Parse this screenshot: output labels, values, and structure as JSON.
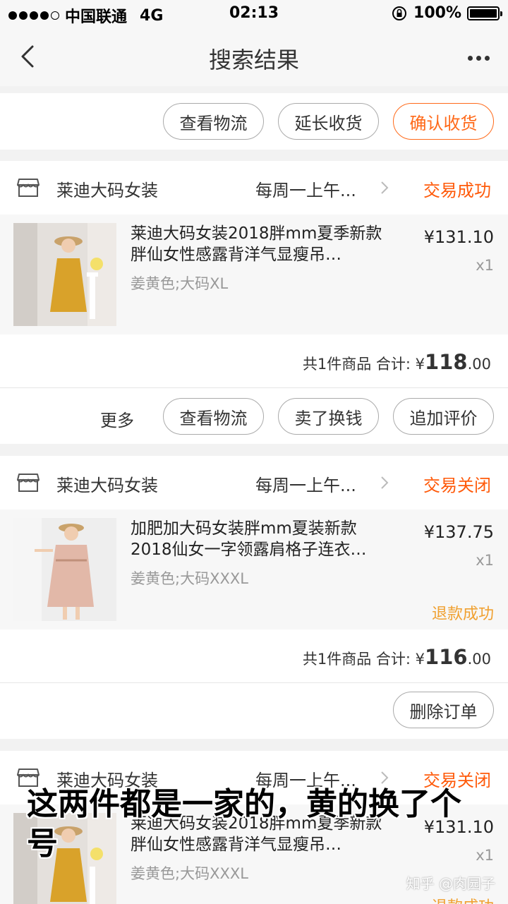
{
  "status_bar": {
    "carrier": "中国联通",
    "network": "4G",
    "time": "02:13",
    "battery": "100%"
  },
  "nav": {
    "title": "搜索结果"
  },
  "top_actions": {
    "btn1": "查看物流",
    "btn2": "延长收货",
    "btn3": "确认收货"
  },
  "orders": [
    {
      "shop": "莱迪大码女装",
      "time": "每周一上午...",
      "status": "交易成功",
      "item_title": "莱迪大码女装2018胖mm夏季新款胖仙女性感露背洋气显瘦吊…",
      "sku": "姜黄色;大码XL",
      "price": "¥131.10",
      "qty": "x1",
      "summary_label": "共1件商品 合计:",
      "summary_currency": "¥",
      "summary_int": "118",
      "summary_dec": ".00",
      "more": "更多",
      "btn1": "查看物流",
      "btn2": "卖了换钱",
      "btn3": "追加评价"
    },
    {
      "shop": "莱迪大码女装",
      "time": "每周一上午...",
      "status": "交易关闭",
      "item_title": "加肥加大码女装胖mm夏装新款2018仙女一字领露肩格子连衣…",
      "sku": "姜黄色;大码XXXL",
      "price": "¥137.75",
      "qty": "x1",
      "refund": "退款成功",
      "summary_label": "共1件商品 合计:",
      "summary_currency": "¥",
      "summary_int": "116",
      "summary_dec": ".00",
      "btn1": "删除订单"
    },
    {
      "shop": "莱迪大码女装",
      "time": "每周一上午...",
      "status": "交易关闭",
      "item_title": "莱迪大码女装2018胖mm夏季新款胖仙女性感露背洋气显瘦吊…",
      "sku": "姜黄色;大码XXXL",
      "price": "¥131.10",
      "qty": "x1",
      "refund": "退款成功"
    }
  ],
  "caption": "这两件都是一家的，黄的换了个号",
  "watermark": "知乎 @肉园子",
  "colors": {
    "accent": "#ff6a1a",
    "status": "#ff5a0a",
    "refund": "#f0a030"
  }
}
